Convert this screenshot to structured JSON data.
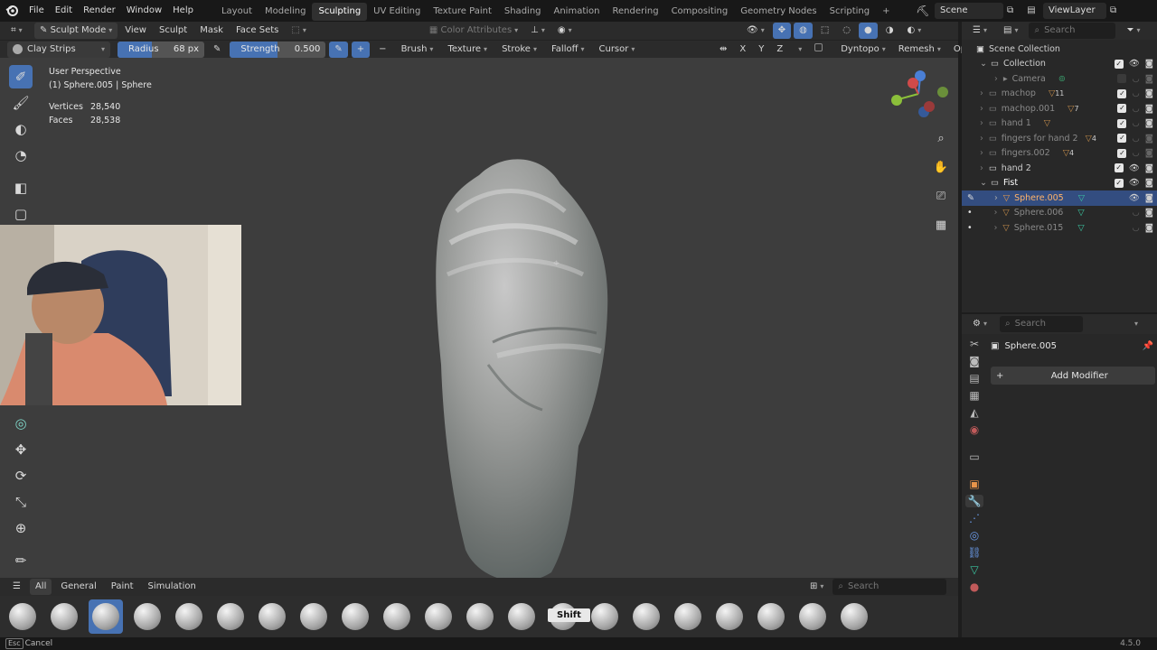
{
  "top_menu": {
    "items": [
      "File",
      "Edit",
      "Render",
      "Window",
      "Help"
    ],
    "workspaces": [
      "Layout",
      "Modeling",
      "Sculpting",
      "UV Editing",
      "Texture Paint",
      "Shading",
      "Animation",
      "Rendering",
      "Compositing",
      "Geometry Nodes",
      "Scripting"
    ],
    "active_workspace": "Sculpting",
    "add_tab": "+",
    "scene": "Scene",
    "view_layer": "ViewLayer"
  },
  "header": {
    "mode": "Sculpt Mode",
    "menus": [
      "View",
      "Sculpt",
      "Mask",
      "Face Sets"
    ],
    "color_attributes": "Color Attributes"
  },
  "tool_settings": {
    "brush_name": "Clay Strips",
    "radius_label": "Radius",
    "radius_value": "68 px",
    "strength_label": "Strength",
    "strength_value": "0.500",
    "menus": [
      "Brush",
      "Texture",
      "Stroke",
      "Falloff",
      "Cursor"
    ],
    "axes": [
      "X",
      "Y",
      "Z"
    ],
    "dyntopo": "Dyntopo",
    "remesh": "Remesh",
    "options": "Options"
  },
  "viewport_info": {
    "perspective": "User Perspective",
    "object": "(1) Sphere.005 | Sphere",
    "vertices_label": "Vertices",
    "vertices_value": "28,540",
    "faces_label": "Faces",
    "faces_value": "28,538"
  },
  "outliner": {
    "search_placeholder": "Search",
    "root": "Scene Collection",
    "rows": [
      {
        "name": "Collection",
        "badge": ""
      },
      {
        "name": "Camera",
        "badge": ""
      },
      {
        "name": "machop",
        "badge": "11"
      },
      {
        "name": "machop.001",
        "badge": "7"
      },
      {
        "name": "hand 1",
        "badge": ""
      },
      {
        "name": "fingers for hand 2",
        "badge": "4"
      },
      {
        "name": "fingers.002",
        "badge": "4"
      },
      {
        "name": "hand 2",
        "badge": ""
      },
      {
        "name": "Fist",
        "badge": ""
      },
      {
        "name": "Sphere.005",
        "badge": ""
      },
      {
        "name": "Sphere.006",
        "badge": ""
      },
      {
        "name": "Sphere.015",
        "badge": ""
      }
    ]
  },
  "properties": {
    "search_placeholder": "Search",
    "object_name": "Sphere.005",
    "add_modifier": "Add Modifier"
  },
  "asset_shelf": {
    "tabs": [
      "All",
      "General",
      "Paint",
      "Simulation"
    ],
    "search_placeholder": "Search",
    "tooltip": "Shift"
  },
  "status": {
    "key": "Esc",
    "action": "Cancel",
    "version": "4.5.0"
  },
  "colors": {
    "accent": "#4772b3",
    "selected_row": "#334d80",
    "viewport_bg": "#3d3d3d"
  }
}
